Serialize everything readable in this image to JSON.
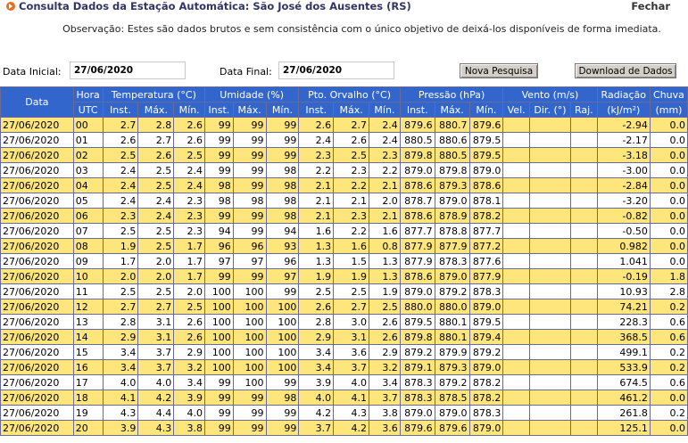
{
  "header": {
    "title": "Consulta Dados da Estação Automática: São José dos Ausentes (RS)",
    "close_label": "Fechar"
  },
  "observation": "Observação: Estes são dados brutos e sem consistência com o único objetivo de deixá-los disponíveis de forma imediata.",
  "filters": {
    "start_label": "Data Inicial:",
    "start_value": "27/06/2020",
    "end_label": "Data Final:",
    "end_value": "27/06/2020",
    "new_search_label": "Nova Pesquisa",
    "download_label": "Download de Dados"
  },
  "table": {
    "group_headers": [
      "Data",
      "Hora",
      "Temperatura (°C)",
      "Umidade (%)",
      "Pto. Orvalho (°C)",
      "Pressão (hPa)",
      "Vento (m/s)",
      "Radiação",
      "Chuva"
    ],
    "sub_headers": [
      "UTC",
      "Inst.",
      "Máx.",
      "Mín.",
      "Inst.",
      "Máx.",
      "Mín.",
      "Inst.",
      "Máx.",
      "Mín.",
      "Inst.",
      "Máx.",
      "Mín.",
      "Vel.",
      "Dir. (°)",
      "Raj.",
      "(kJ/m²)",
      "(mm)"
    ],
    "rows": [
      [
        "27/06/2020",
        "00",
        "2.7",
        "2.8",
        "2.6",
        "99",
        "99",
        "99",
        "2.6",
        "2.7",
        "2.4",
        "879.6",
        "880.7",
        "879.6",
        "",
        "",
        "",
        "-2.94",
        "0.0"
      ],
      [
        "27/06/2020",
        "01",
        "2.6",
        "2.7",
        "2.6",
        "99",
        "99",
        "99",
        "2.4",
        "2.6",
        "2.4",
        "880.5",
        "880.6",
        "879.5",
        "",
        "",
        "",
        "-2.17",
        "0.0"
      ],
      [
        "27/06/2020",
        "02",
        "2.5",
        "2.6",
        "2.5",
        "99",
        "99",
        "99",
        "2.3",
        "2.5",
        "2.3",
        "879.8",
        "880.5",
        "879.5",
        "",
        "",
        "",
        "-3.18",
        "0.0"
      ],
      [
        "27/06/2020",
        "03",
        "2.4",
        "2.5",
        "2.4",
        "99",
        "99",
        "98",
        "2.2",
        "2.3",
        "2.2",
        "879.0",
        "879.8",
        "879.0",
        "",
        "",
        "",
        "-3.00",
        "0.0"
      ],
      [
        "27/06/2020",
        "04",
        "2.4",
        "2.5",
        "2.4",
        "98",
        "99",
        "98",
        "2.1",
        "2.2",
        "2.1",
        "878.6",
        "879.3",
        "878.6",
        "",
        "",
        "",
        "-2.84",
        "0.0"
      ],
      [
        "27/06/2020",
        "05",
        "2.4",
        "2.4",
        "2.3",
        "98",
        "98",
        "98",
        "2.1",
        "2.1",
        "2.0",
        "878.7",
        "879.0",
        "878.1",
        "",
        "",
        "",
        "-3.20",
        "0.0"
      ],
      [
        "27/06/2020",
        "06",
        "2.3",
        "2.4",
        "2.3",
        "99",
        "99",
        "98",
        "2.1",
        "2.3",
        "2.1",
        "878.6",
        "878.9",
        "878.2",
        "",
        "",
        "",
        "-0.82",
        "0.0"
      ],
      [
        "27/06/2020",
        "07",
        "2.5",
        "2.5",
        "2.3",
        "94",
        "99",
        "94",
        "1.6",
        "2.2",
        "1.6",
        "877.7",
        "878.8",
        "877.7",
        "",
        "",
        "",
        "-0.50",
        "0.0"
      ],
      [
        "27/06/2020",
        "08",
        "1.9",
        "2.5",
        "1.7",
        "96",
        "96",
        "93",
        "1.3",
        "1.6",
        "0.8",
        "877.9",
        "877.9",
        "877.2",
        "",
        "",
        "",
        "0.982",
        "0.0"
      ],
      [
        "27/06/2020",
        "09",
        "1.7",
        "2.0",
        "1.7",
        "97",
        "97",
        "96",
        "1.3",
        "1.5",
        "1.3",
        "877.9",
        "878.3",
        "877.6",
        "",
        "",
        "",
        "1.041",
        "0.0"
      ],
      [
        "27/06/2020",
        "10",
        "2.0",
        "2.0",
        "1.7",
        "99",
        "99",
        "97",
        "1.9",
        "1.9",
        "1.3",
        "878.6",
        "879.0",
        "877.9",
        "",
        "",
        "",
        "-0.19",
        "1.8"
      ],
      [
        "27/06/2020",
        "11",
        "2.5",
        "2.5",
        "2.0",
        "100",
        "100",
        "99",
        "2.5",
        "2.5",
        "1.9",
        "879.0",
        "879.2",
        "878.3",
        "",
        "",
        "",
        "10.93",
        "2.8"
      ],
      [
        "27/06/2020",
        "12",
        "2.7",
        "2.7",
        "2.5",
        "100",
        "100",
        "100",
        "2.6",
        "2.7",
        "2.5",
        "880.0",
        "880.0",
        "879.0",
        "",
        "",
        "",
        "74.21",
        "0.2"
      ],
      [
        "27/06/2020",
        "13",
        "2.8",
        "3.1",
        "2.6",
        "100",
        "100",
        "100",
        "2.8",
        "3.0",
        "2.6",
        "879.5",
        "880.1",
        "879.5",
        "",
        "",
        "",
        "228.3",
        "0.6"
      ],
      [
        "27/06/2020",
        "14",
        "2.9",
        "3.1",
        "2.6",
        "100",
        "100",
        "100",
        "2.9",
        "3.1",
        "2.6",
        "879.8",
        "880.1",
        "879.4",
        "",
        "",
        "",
        "368.5",
        "0.6"
      ],
      [
        "27/06/2020",
        "15",
        "3.4",
        "3.7",
        "2.9",
        "100",
        "100",
        "100",
        "3.4",
        "3.6",
        "2.9",
        "879.2",
        "879.9",
        "879.2",
        "",
        "",
        "",
        "499.1",
        "0.2"
      ],
      [
        "27/06/2020",
        "16",
        "3.4",
        "3.7",
        "3.2",
        "100",
        "100",
        "100",
        "3.4",
        "3.7",
        "3.2",
        "879.1",
        "879.3",
        "879.0",
        "",
        "",
        "",
        "533.9",
        "0.2"
      ],
      [
        "27/06/2020",
        "17",
        "4.0",
        "4.0",
        "3.4",
        "99",
        "100",
        "99",
        "3.9",
        "4.0",
        "3.4",
        "878.3",
        "879.2",
        "878.2",
        "",
        "",
        "",
        "674.5",
        "0.6"
      ],
      [
        "27/06/2020",
        "18",
        "4.1",
        "4.2",
        "3.9",
        "99",
        "99",
        "98",
        "4.0",
        "4.1",
        "3.7",
        "878.3",
        "878.5",
        "878.2",
        "",
        "",
        "",
        "461.2",
        "0.0"
      ],
      [
        "27/06/2020",
        "19",
        "4.3",
        "4.4",
        "4.0",
        "99",
        "99",
        "99",
        "4.2",
        "4.3",
        "3.8",
        "879.0",
        "879.0",
        "878.3",
        "",
        "",
        "",
        "261.8",
        "0.2"
      ],
      [
        "27/06/2020",
        "20",
        "3.9",
        "4.3",
        "3.8",
        "99",
        "99",
        "99",
        "3.7",
        "4.2",
        "3.6",
        "879.6",
        "879.6",
        "879.0",
        "",
        "",
        "",
        "125.1",
        "0.0"
      ]
    ]
  }
}
